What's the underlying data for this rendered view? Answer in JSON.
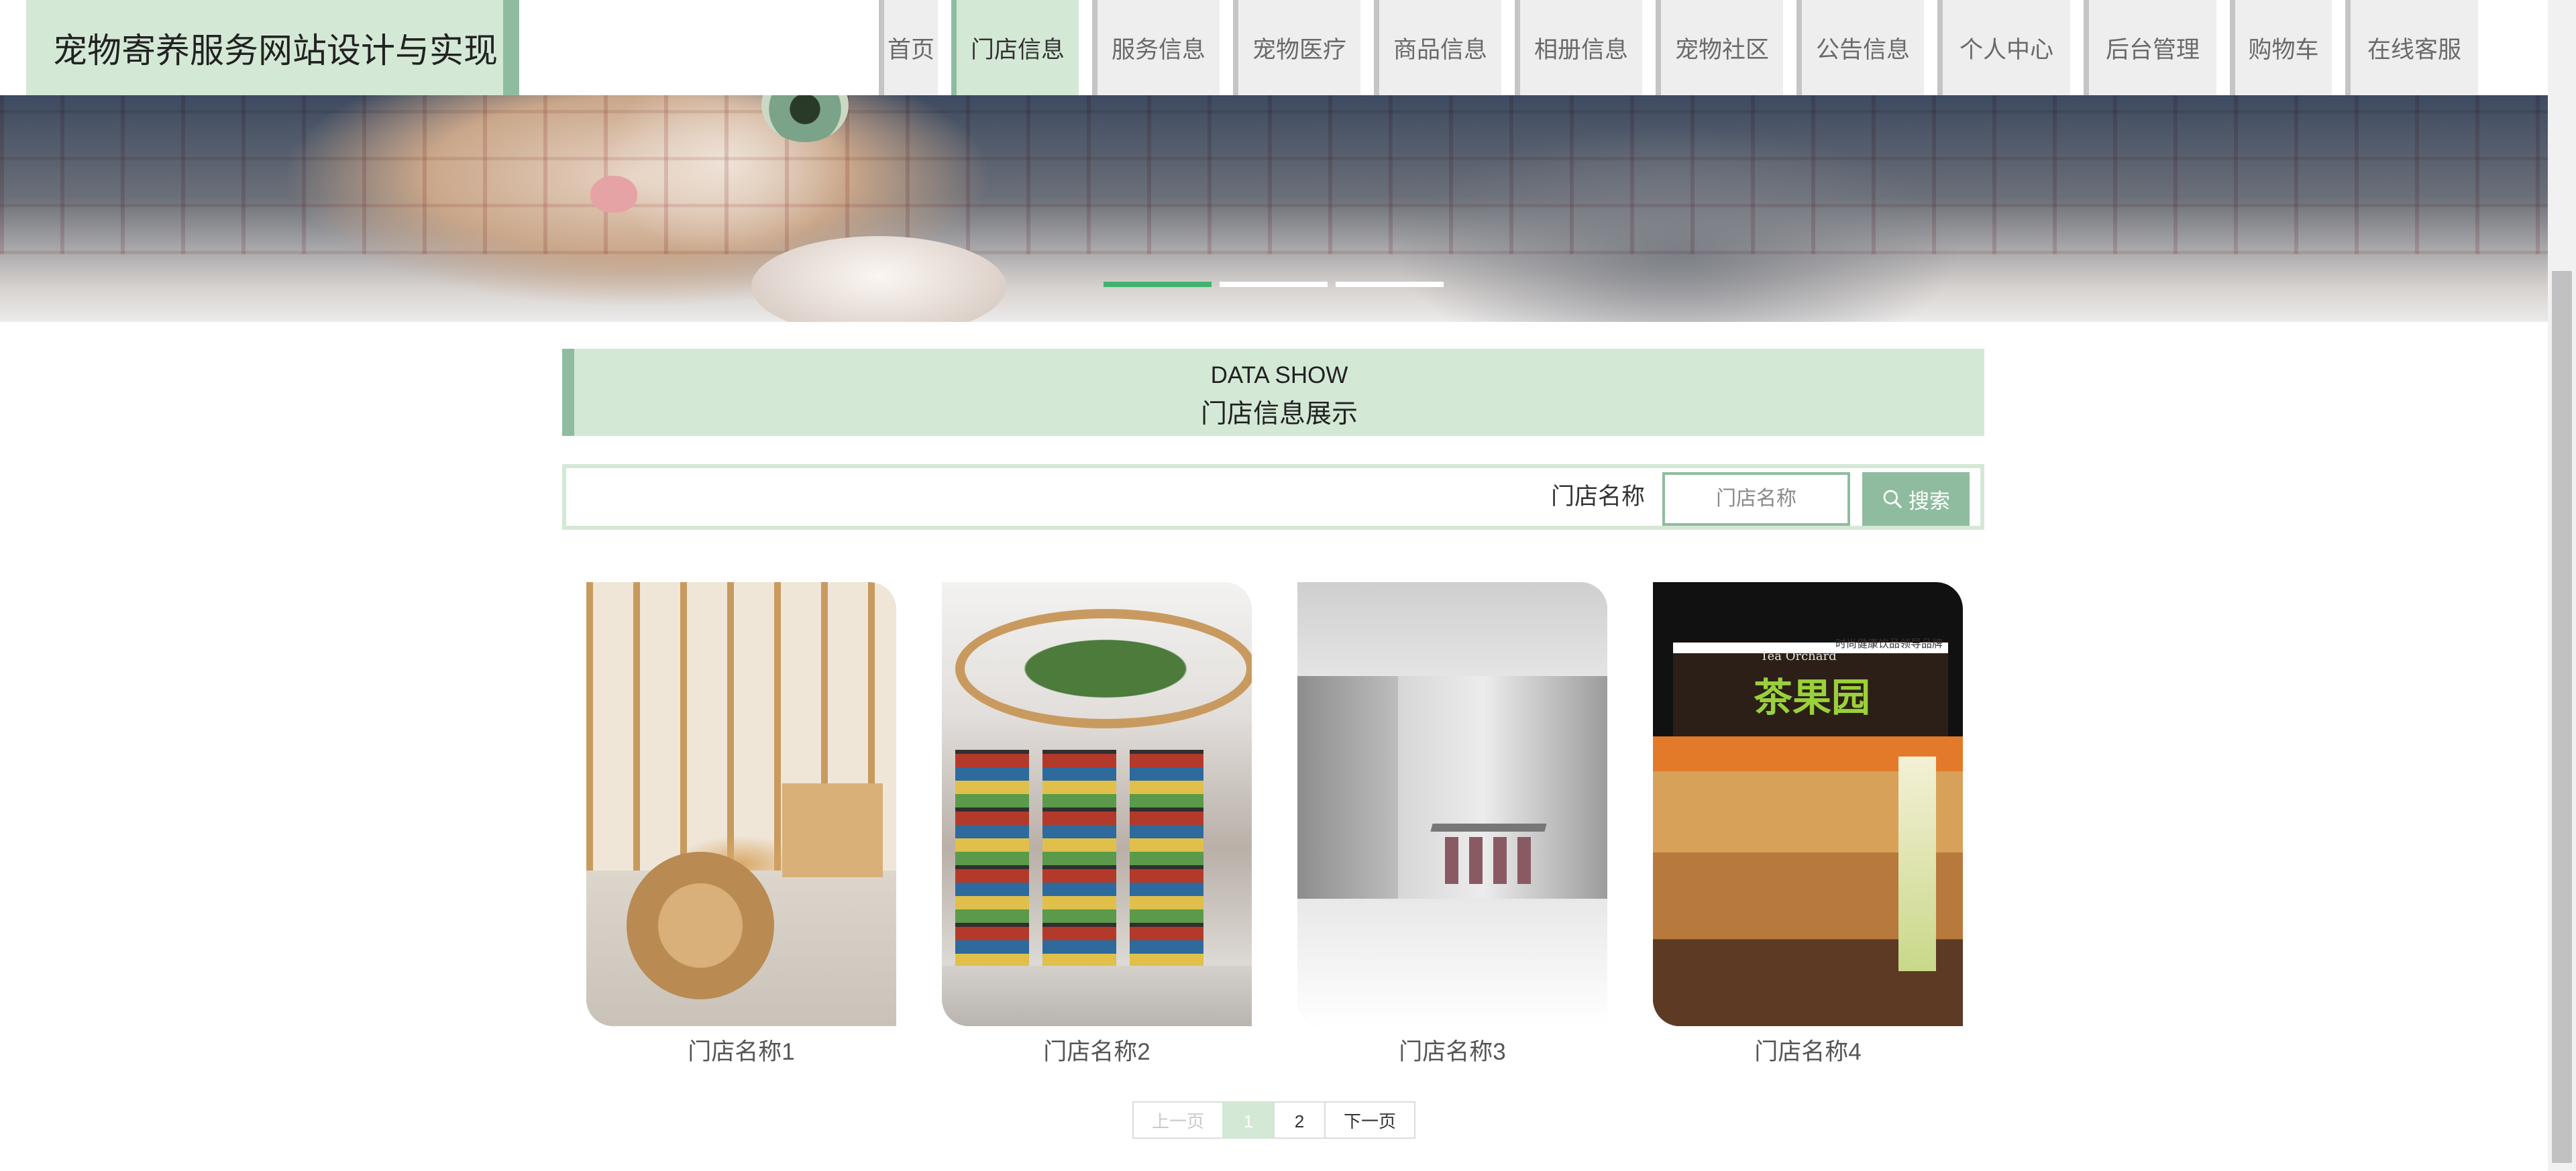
{
  "site": {
    "title": "宠物寄养服务网站设计与实现"
  },
  "nav": {
    "items": [
      {
        "label": "首页",
        "active": false
      },
      {
        "label": "门店信息",
        "active": true
      },
      {
        "label": "服务信息",
        "active": false
      },
      {
        "label": "宠物医疗",
        "active": false
      },
      {
        "label": "商品信息",
        "active": false
      },
      {
        "label": "相册信息",
        "active": false
      },
      {
        "label": "宠物社区",
        "active": false
      },
      {
        "label": "公告信息",
        "active": false
      },
      {
        "label": "个人中心",
        "active": false
      },
      {
        "label": "后台管理",
        "active": false
      },
      {
        "label": "购物车",
        "active": false
      },
      {
        "label": "在线客服",
        "active": false
      }
    ]
  },
  "banner": {
    "slide_count": 3,
    "active_slide": 1
  },
  "section": {
    "title_en": "DATA SHOW",
    "title_cn": "门店信息展示"
  },
  "search": {
    "label": "门店名称",
    "placeholder": "门店名称",
    "value": "",
    "button_label": "搜索",
    "button_icon": "search-icon"
  },
  "stores": [
    {
      "name": "门店名称1"
    },
    {
      "name": "门店名称2"
    },
    {
      "name": "门店名称3"
    },
    {
      "name": "门店名称4",
      "sign_text": "茶果园",
      "sign_en": "Tea Orchard",
      "sign_tag": "时尚健康饮品领导品牌"
    }
  ],
  "pagination": {
    "prev_label": "上一页",
    "pages": [
      "1",
      "2"
    ],
    "current_page": "1",
    "next_label": "下一页"
  },
  "colors": {
    "accent_light": "#d4e8d6",
    "accent": "#8fbc9f",
    "slide_active": "#3fb36e"
  }
}
